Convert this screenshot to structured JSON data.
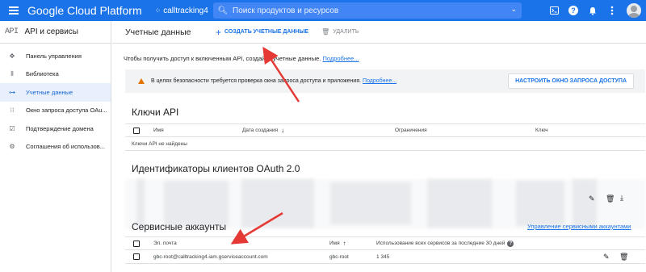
{
  "topbar": {
    "brand": "Google Cloud Platform",
    "project": "calltracking4",
    "search_placeholder": "Поиск продуктов и ресурсов",
    "icons": [
      "cloud-shell-icon",
      "help-icon",
      "notifications-icon",
      "more-vert-icon",
      "account-avatar"
    ]
  },
  "sidebar": {
    "logo": "API",
    "title": "API и сервисы",
    "items": [
      {
        "label": "Панель управления",
        "icon": "dashboard-icon"
      },
      {
        "label": "Библиотека",
        "icon": "library-icon"
      },
      {
        "label": "Учетные данные",
        "icon": "key-icon",
        "active": true
      },
      {
        "label": "Окно запроса доступа OAu...",
        "icon": "consent-screen-icon"
      },
      {
        "label": "Подтверждение домена",
        "icon": "domain-icon"
      },
      {
        "label": "Соглашения об использов...",
        "icon": "agreements-icon"
      }
    ]
  },
  "toolbar": {
    "title": "Учетные данные",
    "create_label": "Создать учетные данные",
    "delete_label": "Удалить"
  },
  "intro": {
    "text": "Чтобы получить доступ к включенным API, создайте учетные данные.",
    "link": "Подробнее..."
  },
  "warning": {
    "text": "В целях безопасности требуется проверка окна запроса доступа и приложения.",
    "link": "Подробнее...",
    "button": "Настроить окно запроса доступа"
  },
  "api_keys": {
    "title": "Ключи API",
    "columns": [
      "Имя",
      "Дата создания",
      "Ограничения",
      "Ключ"
    ],
    "empty": "Ключи API не найдены"
  },
  "oauth": {
    "title": "Идентификаторы клиентов OAuth 2.0"
  },
  "service_accounts": {
    "title": "Сервисные аккаунты",
    "manage_link": "Управление сервисными аккаунтами",
    "columns": [
      "Эл. почта",
      "Имя",
      "Использование всех сервисов за последние 30 дней"
    ],
    "rows": [
      {
        "email": "gbc-root@calltracking4.iam.gserviceaccount.com",
        "name": "gbc-root",
        "usage": "1 345"
      }
    ]
  },
  "colors": {
    "topbar": "#1a73e8",
    "accent": "#1a73e8",
    "annotation_arrow": "#e53935",
    "warning": "#e37400"
  }
}
